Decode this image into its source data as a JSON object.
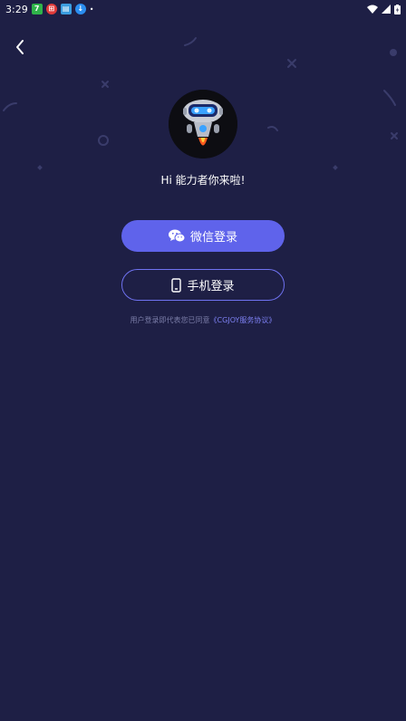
{
  "status_bar": {
    "time": "3:29",
    "notification_icons": [
      {
        "name": "app-7-icon",
        "glyph": "7",
        "color": "#2fb34a"
      },
      {
        "name": "app-red-icon",
        "glyph": "⊞",
        "color": "#e03a3a"
      },
      {
        "name": "app-photo-icon",
        "glyph": "▤",
        "color": "#3b9de0"
      },
      {
        "name": "app-download-icon",
        "glyph": "↓",
        "color": "#2b8ef0"
      }
    ],
    "dot": "•"
  },
  "greeting": "Hi 能力者你来啦!",
  "buttons": {
    "wechat_label": "微信登录",
    "phone_label": "手机登录"
  },
  "agreement": {
    "prefix": "用户登录即代表您已同意",
    "link": "《CGJOY服务协议》"
  },
  "colors": {
    "background": "#1e1f45",
    "primary": "#5f63eb",
    "outline": "#6f72f0",
    "link": "#7d80f2"
  }
}
